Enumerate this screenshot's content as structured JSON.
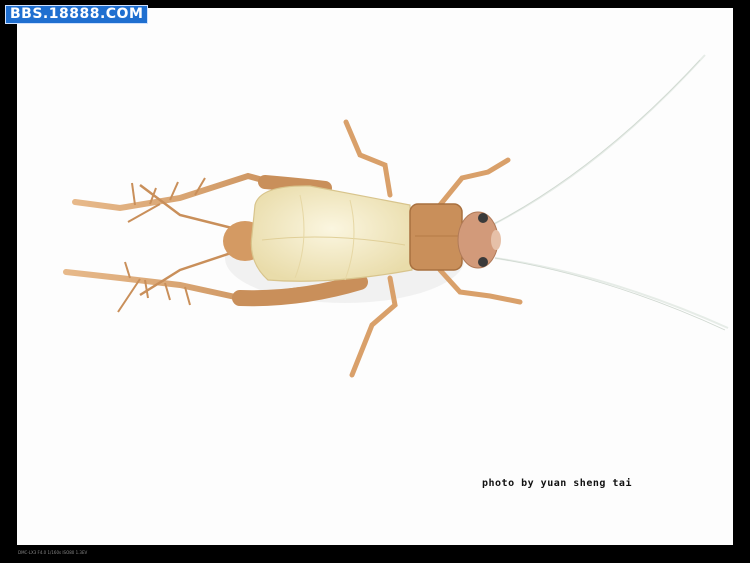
{
  "watermark": {
    "text": "BBS.18888.COM"
  },
  "credit": {
    "text": "photo by yuan sheng tai"
  },
  "exif": {
    "text": "DMC-LX3 F4.0 1/160s ISO80 1.3EV"
  },
  "subject": {
    "icon": "cricket-icon"
  },
  "colors": {
    "background": "#fdfdfd",
    "frame": "#000000",
    "watermark_bg": "#1f6fd0",
    "body": "#c98f5a",
    "wings": "#f3ebc8",
    "antennae": "#e8eee8"
  }
}
